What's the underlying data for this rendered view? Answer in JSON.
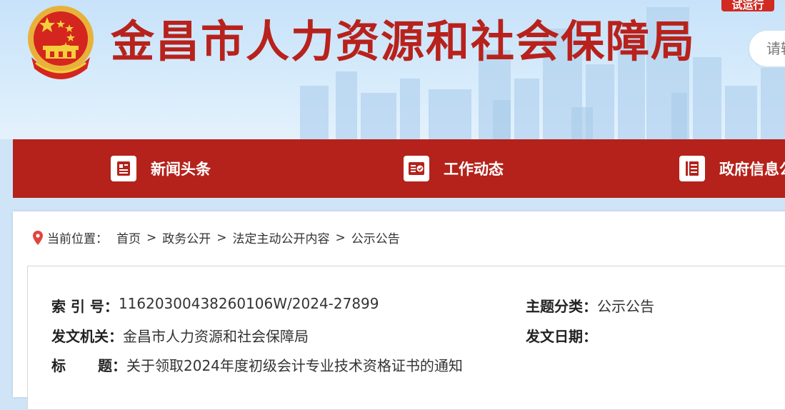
{
  "header": {
    "site_title": "金昌市人力资源和社会保障局",
    "trial_badge": "试运行",
    "search": {
      "placeholder": "请输入关键词"
    }
  },
  "nav": {
    "items": [
      {
        "label": "新闻头条",
        "icon": "newspaper-icon"
      },
      {
        "label": "工作动态",
        "icon": "checklist-icon"
      },
      {
        "label": "政府信息公开",
        "icon": "list-icon"
      }
    ]
  },
  "breadcrumb": {
    "label": "当前位置：",
    "items": [
      "首页",
      "政务公开",
      "法定主动公开内容",
      "公示公告"
    ],
    "separator": ">"
  },
  "meta": {
    "index_no_label": "索 引 号：",
    "index_no_value": "11620300438260106W/2024-27899",
    "topic_label": "主题分类：",
    "topic_value": "公示公告",
    "issuer_label": "发文机关：",
    "issuer_value": "金昌市人力资源和社会保障局",
    "date_label": "发文日期：",
    "date_value": "",
    "title_label_a": "标",
    "title_label_b": "题：",
    "title_value": "关于领取2024年度初级会计专业技术资格证书的通知"
  },
  "colors": {
    "brand_red": "#b4221b",
    "title_red": "#b8221c",
    "header_sky": "#c7e2fa"
  }
}
